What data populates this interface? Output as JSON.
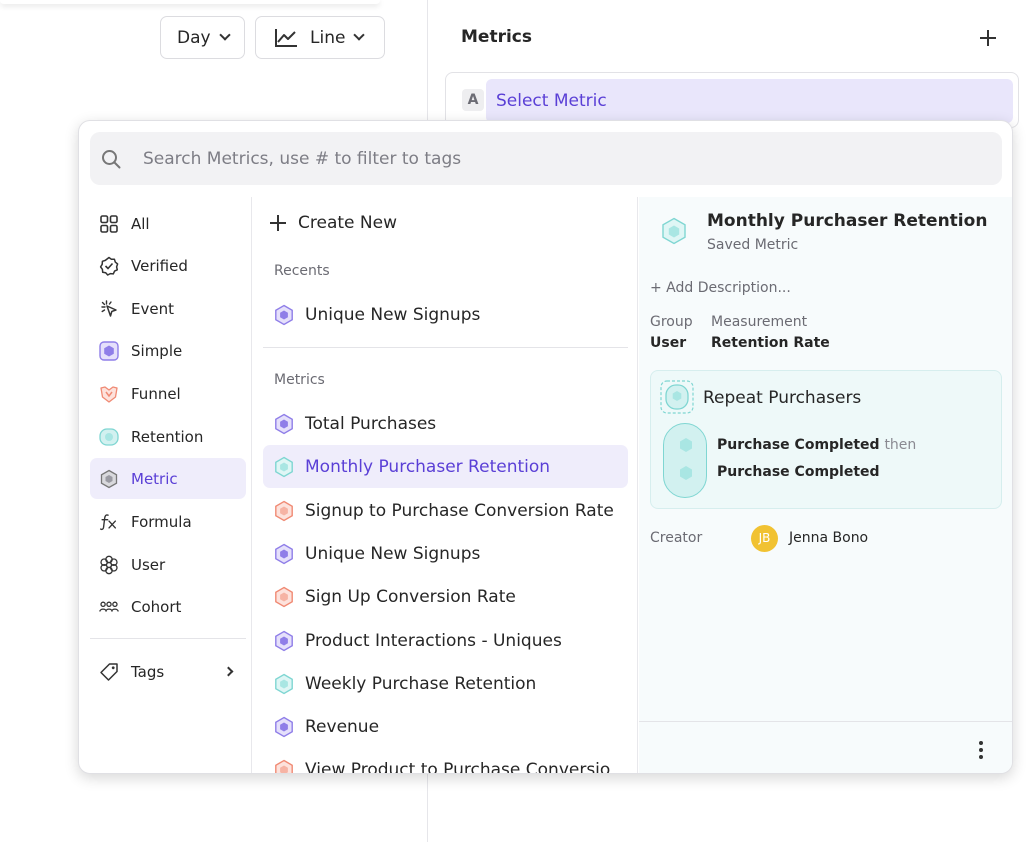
{
  "toolbar": {
    "day_label": "Day",
    "chart_type_label": "Line"
  },
  "metrics_panel": {
    "title": "Metrics",
    "slot_letter": "A",
    "select_label": "Select Metric"
  },
  "picker": {
    "search_placeholder": "Search Metrics, use # to filter to tags",
    "nav": [
      {
        "label": "All",
        "icon": "grid-icon"
      },
      {
        "label": "Verified",
        "icon": "verified-badge-icon"
      },
      {
        "label": "Event",
        "icon": "cursor-click-icon"
      },
      {
        "label": "Simple",
        "icon": "simple-metric-icon"
      },
      {
        "label": "Funnel",
        "icon": "funnel-icon"
      },
      {
        "label": "Retention",
        "icon": "retention-icon"
      },
      {
        "label": "Metric",
        "icon": "metric-hex-icon",
        "active": true
      },
      {
        "label": "Formula",
        "icon": "formula-fx-icon"
      },
      {
        "label": "User",
        "icon": "user-flower-icon"
      },
      {
        "label": "Cohort",
        "icon": "cohort-people-icon"
      }
    ],
    "tags_label": "Tags",
    "create_new_label": "Create New",
    "recents_label": "Recents",
    "recents": [
      {
        "label": "Unique New Signups",
        "kind": "simple"
      }
    ],
    "metrics_label": "Metrics",
    "metrics": [
      {
        "label": "Total Purchases",
        "kind": "simple"
      },
      {
        "label": "Monthly Purchaser Retention",
        "kind": "retention",
        "active": true
      },
      {
        "label": "Signup to Purchase Conversion Rate",
        "kind": "funnel"
      },
      {
        "label": "Unique New Signups",
        "kind": "simple"
      },
      {
        "label": "Sign Up Conversion Rate",
        "kind": "funnel"
      },
      {
        "label": "Product Interactions - Uniques",
        "kind": "simple"
      },
      {
        "label": "Weekly Purchase Retention",
        "kind": "retention"
      },
      {
        "label": "Revenue",
        "kind": "simple"
      },
      {
        "label": "View Product to Purchase Conversio",
        "kind": "funnel"
      }
    ],
    "detail": {
      "title": "Monthly Purchaser Retention",
      "subtitle": "Saved Metric",
      "add_description": "+ Add Description...",
      "group_label": "Group",
      "group_value": "User",
      "measurement_label": "Measurement",
      "measurement_value": "Retention Rate",
      "card_title": "Repeat Purchasers",
      "step1": "Purchase Completed",
      "then_label": "then",
      "step2": "Purchase Completed",
      "creator_label": "Creator",
      "creator_initials": "JB",
      "creator_name": "Jenna Bono"
    }
  },
  "colors": {
    "accent": "#5a3fd6",
    "simple": "#8f7ee8",
    "retention": "#7fd6d2",
    "funnel": "#f08a74",
    "avatar": "#f1c232"
  }
}
